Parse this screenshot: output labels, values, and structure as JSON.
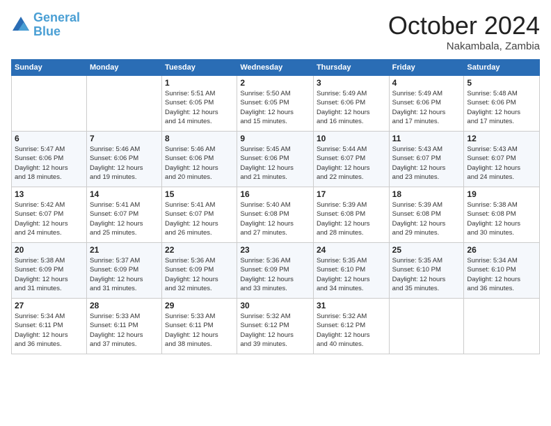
{
  "logo": {
    "line1": "General",
    "line2": "Blue"
  },
  "header": {
    "month": "October 2024",
    "location": "Nakambala, Zambia"
  },
  "weekdays": [
    "Sunday",
    "Monday",
    "Tuesday",
    "Wednesday",
    "Thursday",
    "Friday",
    "Saturday"
  ],
  "weeks": [
    [
      {
        "day": "",
        "info": ""
      },
      {
        "day": "",
        "info": ""
      },
      {
        "day": "1",
        "info": "Sunrise: 5:51 AM\nSunset: 6:05 PM\nDaylight: 12 hours\nand 14 minutes."
      },
      {
        "day": "2",
        "info": "Sunrise: 5:50 AM\nSunset: 6:05 PM\nDaylight: 12 hours\nand 15 minutes."
      },
      {
        "day": "3",
        "info": "Sunrise: 5:49 AM\nSunset: 6:06 PM\nDaylight: 12 hours\nand 16 minutes."
      },
      {
        "day": "4",
        "info": "Sunrise: 5:49 AM\nSunset: 6:06 PM\nDaylight: 12 hours\nand 17 minutes."
      },
      {
        "day": "5",
        "info": "Sunrise: 5:48 AM\nSunset: 6:06 PM\nDaylight: 12 hours\nand 17 minutes."
      }
    ],
    [
      {
        "day": "6",
        "info": "Sunrise: 5:47 AM\nSunset: 6:06 PM\nDaylight: 12 hours\nand 18 minutes."
      },
      {
        "day": "7",
        "info": "Sunrise: 5:46 AM\nSunset: 6:06 PM\nDaylight: 12 hours\nand 19 minutes."
      },
      {
        "day": "8",
        "info": "Sunrise: 5:46 AM\nSunset: 6:06 PM\nDaylight: 12 hours\nand 20 minutes."
      },
      {
        "day": "9",
        "info": "Sunrise: 5:45 AM\nSunset: 6:06 PM\nDaylight: 12 hours\nand 21 minutes."
      },
      {
        "day": "10",
        "info": "Sunrise: 5:44 AM\nSunset: 6:07 PM\nDaylight: 12 hours\nand 22 minutes."
      },
      {
        "day": "11",
        "info": "Sunrise: 5:43 AM\nSunset: 6:07 PM\nDaylight: 12 hours\nand 23 minutes."
      },
      {
        "day": "12",
        "info": "Sunrise: 5:43 AM\nSunset: 6:07 PM\nDaylight: 12 hours\nand 24 minutes."
      }
    ],
    [
      {
        "day": "13",
        "info": "Sunrise: 5:42 AM\nSunset: 6:07 PM\nDaylight: 12 hours\nand 24 minutes."
      },
      {
        "day": "14",
        "info": "Sunrise: 5:41 AM\nSunset: 6:07 PM\nDaylight: 12 hours\nand 25 minutes."
      },
      {
        "day": "15",
        "info": "Sunrise: 5:41 AM\nSunset: 6:07 PM\nDaylight: 12 hours\nand 26 minutes."
      },
      {
        "day": "16",
        "info": "Sunrise: 5:40 AM\nSunset: 6:08 PM\nDaylight: 12 hours\nand 27 minutes."
      },
      {
        "day": "17",
        "info": "Sunrise: 5:39 AM\nSunset: 6:08 PM\nDaylight: 12 hours\nand 28 minutes."
      },
      {
        "day": "18",
        "info": "Sunrise: 5:39 AM\nSunset: 6:08 PM\nDaylight: 12 hours\nand 29 minutes."
      },
      {
        "day": "19",
        "info": "Sunrise: 5:38 AM\nSunset: 6:08 PM\nDaylight: 12 hours\nand 30 minutes."
      }
    ],
    [
      {
        "day": "20",
        "info": "Sunrise: 5:38 AM\nSunset: 6:09 PM\nDaylight: 12 hours\nand 31 minutes."
      },
      {
        "day": "21",
        "info": "Sunrise: 5:37 AM\nSunset: 6:09 PM\nDaylight: 12 hours\nand 31 minutes."
      },
      {
        "day": "22",
        "info": "Sunrise: 5:36 AM\nSunset: 6:09 PM\nDaylight: 12 hours\nand 32 minutes."
      },
      {
        "day": "23",
        "info": "Sunrise: 5:36 AM\nSunset: 6:09 PM\nDaylight: 12 hours\nand 33 minutes."
      },
      {
        "day": "24",
        "info": "Sunrise: 5:35 AM\nSunset: 6:10 PM\nDaylight: 12 hours\nand 34 minutes."
      },
      {
        "day": "25",
        "info": "Sunrise: 5:35 AM\nSunset: 6:10 PM\nDaylight: 12 hours\nand 35 minutes."
      },
      {
        "day": "26",
        "info": "Sunrise: 5:34 AM\nSunset: 6:10 PM\nDaylight: 12 hours\nand 36 minutes."
      }
    ],
    [
      {
        "day": "27",
        "info": "Sunrise: 5:34 AM\nSunset: 6:11 PM\nDaylight: 12 hours\nand 36 minutes."
      },
      {
        "day": "28",
        "info": "Sunrise: 5:33 AM\nSunset: 6:11 PM\nDaylight: 12 hours\nand 37 minutes."
      },
      {
        "day": "29",
        "info": "Sunrise: 5:33 AM\nSunset: 6:11 PM\nDaylight: 12 hours\nand 38 minutes."
      },
      {
        "day": "30",
        "info": "Sunrise: 5:32 AM\nSunset: 6:12 PM\nDaylight: 12 hours\nand 39 minutes."
      },
      {
        "day": "31",
        "info": "Sunrise: 5:32 AM\nSunset: 6:12 PM\nDaylight: 12 hours\nand 40 minutes."
      },
      {
        "day": "",
        "info": ""
      },
      {
        "day": "",
        "info": ""
      }
    ]
  ]
}
